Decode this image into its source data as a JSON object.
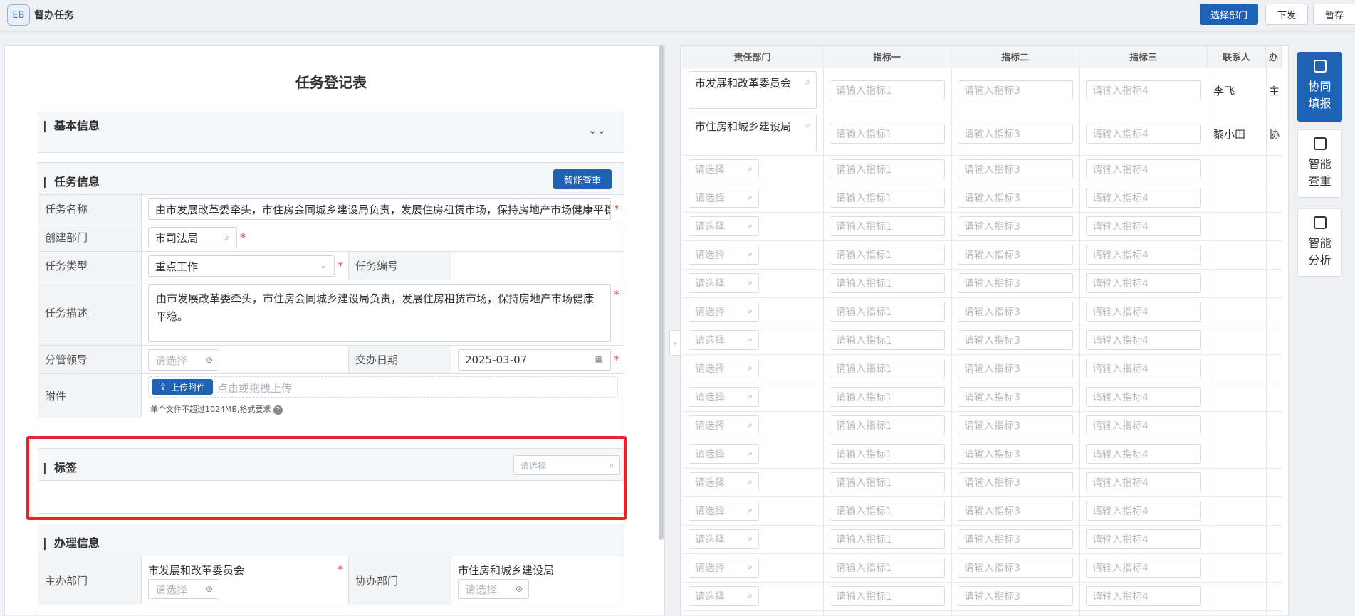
{
  "app": {
    "logo": "EB",
    "title": "督办任务"
  },
  "toolbar": {
    "select_dept": "选择部门",
    "issue": "下发",
    "save": "暂存"
  },
  "form": {
    "title": "任务登记表",
    "sections": {
      "basic": "基本信息",
      "task": "任务信息",
      "tags": "标签",
      "handle": "办理信息"
    },
    "smart_check": "智能查重",
    "task_name_label": "任务名称",
    "task_name_value": "由市发展改革委牵头，市住房会同城乡建设局负责，发展住房租赁市场，保持房地产市场健康平稳。",
    "create_dept_label": "创建部门",
    "create_dept_value": "市司法局",
    "task_type_label": "任务类型",
    "task_type_value": "重点工作",
    "task_no_label": "任务编号",
    "task_desc_label": "任务描述",
    "task_desc_value": "由市发展改革委牵头，市住房会同城乡建设局负责，发展住房租赁市场，保持房地产市场健康平稳。",
    "leader_label": "分管领导",
    "leader_placeholder": "请选择",
    "date_label": "交办日期",
    "date_value": "2025-03-07",
    "attach_label": "附件",
    "upload_button": "上传附件",
    "upload_hint": "点击或拖拽上传",
    "upload_note": "单个文件不超过1024MB,格式要求",
    "tag_placeholder": "请选择",
    "main_dept_label": "主办部门",
    "main_dept_value": "市发展和改革委员会",
    "main_dept_placeholder": "请选择",
    "co_dept_label": "协办部门",
    "co_dept_value": "市住房和城乡建设局",
    "co_dept_placeholder": "请选择"
  },
  "table": {
    "columns": [
      "责任部门",
      "指标一",
      "指标二",
      "指标三",
      "联系人",
      "办"
    ],
    "placeholders": {
      "dept": "请选择",
      "ind1": "请输入指标1",
      "ind2": "请输入指标3",
      "ind3": "请输入指标4"
    },
    "rows": [
      {
        "dept": "市发展和改革委员会",
        "contact": "李飞",
        "role": "主"
      },
      {
        "dept": "市住房和城乡建设局",
        "contact": "黎小田",
        "role": "协"
      }
    ],
    "empty_rows": 16
  },
  "side_actions": [
    {
      "label": "协同填报",
      "icon": "edit-icon",
      "active": true
    },
    {
      "label": "智能查重",
      "icon": "filter-icon",
      "active": false
    },
    {
      "label": "智能分析",
      "icon": "analysis-icon",
      "active": false
    }
  ],
  "colors": {
    "primary": "#1f62b4",
    "required": "#e23b3b",
    "highlight": "#e8242b"
  }
}
